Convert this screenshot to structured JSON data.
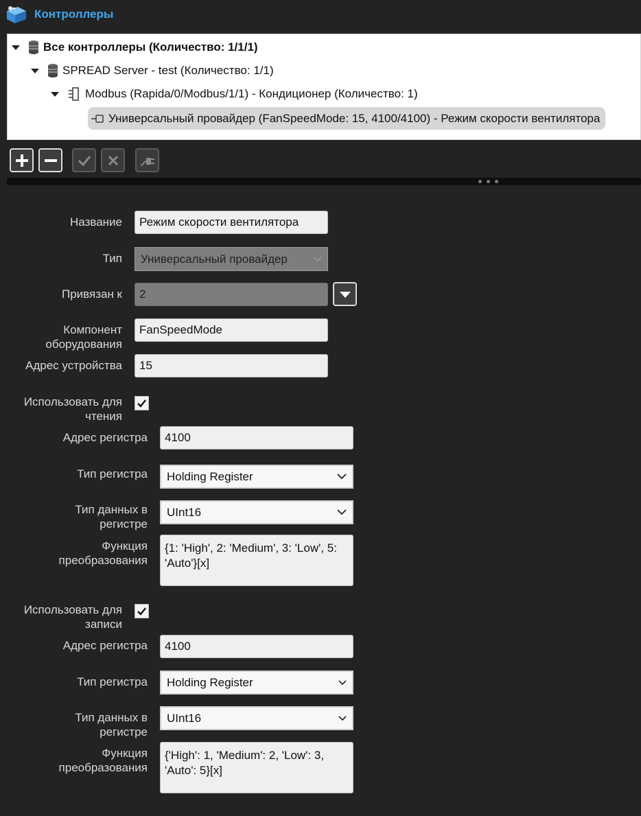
{
  "header": {
    "title": "Контроллеры",
    "icon": "controllers-icon"
  },
  "tree": {
    "root": {
      "label": "Все контроллеры (Количество: 1/1/1)",
      "icon": "database-icon"
    },
    "server": {
      "label": "SPREAD Server  - test (Количество: 1/1)",
      "icon": "database-icon"
    },
    "device": {
      "label": "Modbus (Rapida/0/Modbus/1/1) - Кондиционер (Количество: 1)",
      "icon": "device-icon"
    },
    "provider": {
      "label": "Универсальный провайдер (FanSpeedMode: 15, 4100/4100) - Режим скорости вентилятора",
      "icon": "plug-node-icon"
    }
  },
  "toolbar": {
    "buttons": [
      {
        "name": "add",
        "icon": "plus-icon",
        "enabled": true
      },
      {
        "name": "remove",
        "icon": "minus-icon",
        "enabled": true
      },
      {
        "name": "apply",
        "icon": "check-icon",
        "enabled": false
      },
      {
        "name": "cancel",
        "icon": "close-icon",
        "enabled": false
      },
      {
        "name": "connect",
        "icon": "plug-icon",
        "enabled": false
      }
    ]
  },
  "form": {
    "name": {
      "label": "Название",
      "value": "Режим скорости вентилятора"
    },
    "type": {
      "label": "Тип",
      "value": "Универсальный провайдер"
    },
    "bound_to": {
      "label": "Привязан к",
      "value": "2"
    },
    "component": {
      "label": "Компонент оборудования",
      "value": "FanSpeedMode"
    },
    "device_address": {
      "label": "Адрес устройства",
      "value": "15"
    },
    "read": {
      "enable_label": "Использовать для чтения",
      "enabled": true,
      "register_address": {
        "label": "Адрес регистра",
        "value": "4100"
      },
      "register_type": {
        "label": "Тип регистра",
        "value": "Holding Register"
      },
      "data_type": {
        "label": "Тип данных в регистре",
        "value": "UInt16"
      },
      "conversion": {
        "label": "Функция преобразования",
        "value": "{1: 'High', 2: 'Medium', 3: 'Low', 5: 'Auto'}[x]"
      }
    },
    "write": {
      "enable_label": "Использовать для записи",
      "enabled": true,
      "register_address": {
        "label": "Адрес регистра",
        "value": "4100"
      },
      "register_type": {
        "label": "Тип регистра",
        "value": "Holding Register"
      },
      "data_type": {
        "label": "Тип данных в регистре",
        "value": "UInt16"
      },
      "conversion": {
        "label": "Функция преобразования",
        "value": "{'High': 1, 'Medium': 2, 'Low': 3, 'Auto': 5}[x]"
      }
    }
  },
  "colors": {
    "accent": "#3ba8f0",
    "background": "#232323",
    "panel": "#ffffff"
  }
}
